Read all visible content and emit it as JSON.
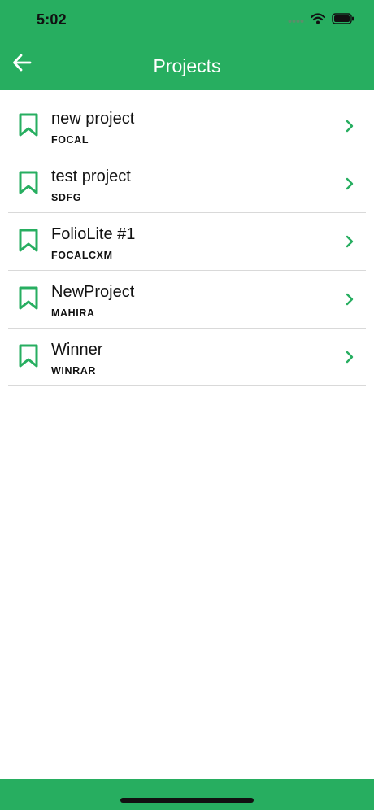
{
  "status_bar": {
    "time": "5:02",
    "icons": [
      "signal-dots-icon",
      "wifi-icon",
      "battery-icon"
    ]
  },
  "header": {
    "title": "Projects",
    "back_icon": "arrow-left-icon"
  },
  "projects": [
    {
      "name": "new project",
      "code": "FOCAL"
    },
    {
      "name": "test project",
      "code": "SDFG"
    },
    {
      "name": "FolioLite #1",
      "code": "FOCALCXM"
    },
    {
      "name": "NewProject",
      "code": "MAHIRA"
    },
    {
      "name": "Winner",
      "code": "WINRAR"
    }
  ],
  "row_icons": {
    "leading": "bookmark-icon",
    "trailing": "chevron-right-icon"
  },
  "colors": {
    "accent": "#27ae60",
    "text": "#111111",
    "divider": "#d9d9d9",
    "background": "#ffffff"
  }
}
